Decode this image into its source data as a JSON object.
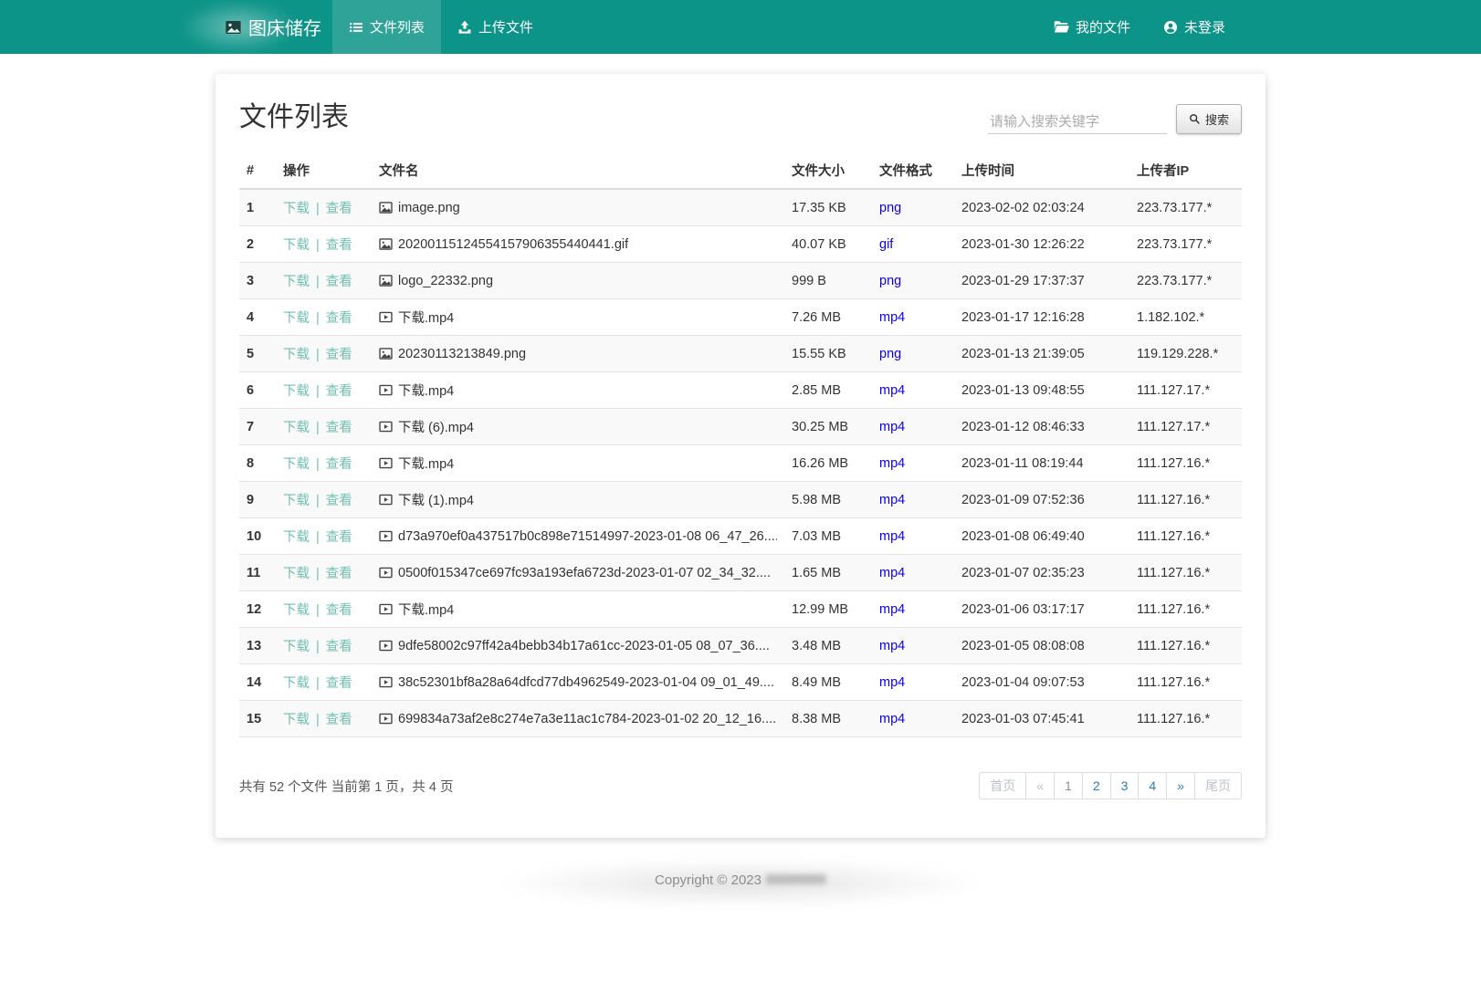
{
  "navbar": {
    "brand": "图床储存",
    "items": [
      {
        "id": "file-list",
        "label": "文件列表",
        "icon": "list-icon",
        "active": true
      },
      {
        "id": "upload-file",
        "label": "上传文件",
        "icon": "upload-icon",
        "active": false
      }
    ],
    "right_items": [
      {
        "id": "my-files",
        "label": "我的文件",
        "icon": "folder-icon"
      },
      {
        "id": "login-status",
        "label": "未登录",
        "icon": "user-icon"
      }
    ]
  },
  "page": {
    "title": "文件列表"
  },
  "search": {
    "placeholder": "请输入搜索关键字",
    "button_label": "搜索"
  },
  "table": {
    "headers": [
      "#",
      "操作",
      "文件名",
      "文件大小",
      "文件格式",
      "上传时间",
      "上传者IP"
    ],
    "action_labels": {
      "download": "下载",
      "separator": "|",
      "view": "查看"
    },
    "rows": [
      {
        "index": 1,
        "icon": "image-icon",
        "filename": "image.png",
        "size": "17.35 KB",
        "format": "png",
        "time": "2023-02-02 02:03:24",
        "ip": "223.73.177.*"
      },
      {
        "index": 2,
        "icon": "image-icon",
        "filename": "20200115124554157906355440441.gif",
        "size": "40.07 KB",
        "format": "gif",
        "time": "2023-01-30 12:26:22",
        "ip": "223.73.177.*"
      },
      {
        "index": 3,
        "icon": "image-icon",
        "filename": "logo_22332.png",
        "size": "999 B",
        "format": "png",
        "time": "2023-01-29 17:37:37",
        "ip": "223.73.177.*"
      },
      {
        "index": 4,
        "icon": "video-icon",
        "filename": "下载.mp4",
        "size": "7.26 MB",
        "format": "mp4",
        "time": "2023-01-17 12:16:28",
        "ip": "1.182.102.*"
      },
      {
        "index": 5,
        "icon": "image-icon",
        "filename": "20230113213849.png",
        "size": "15.55 KB",
        "format": "png",
        "time": "2023-01-13 21:39:05",
        "ip": "119.129.228.*"
      },
      {
        "index": 6,
        "icon": "video-icon",
        "filename": "下载.mp4",
        "size": "2.85 MB",
        "format": "mp4",
        "time": "2023-01-13 09:48:55",
        "ip": "111.127.17.*"
      },
      {
        "index": 7,
        "icon": "video-icon",
        "filename": "下载 (6).mp4",
        "size": "30.25 MB",
        "format": "mp4",
        "time": "2023-01-12 08:46:33",
        "ip": "111.127.17.*"
      },
      {
        "index": 8,
        "icon": "video-icon",
        "filename": "下载.mp4",
        "size": "16.26 MB",
        "format": "mp4",
        "time": "2023-01-11 08:19:44",
        "ip": "111.127.16.*"
      },
      {
        "index": 9,
        "icon": "video-icon",
        "filename": "下载 (1).mp4",
        "size": "5.98 MB",
        "format": "mp4",
        "time": "2023-01-09 07:52:36",
        "ip": "111.127.16.*"
      },
      {
        "index": 10,
        "icon": "video-icon",
        "filename": "d73a970ef0a437517b0c898e71514997-2023-01-08 06_47_26....",
        "size": "7.03 MB",
        "format": "mp4",
        "time": "2023-01-08 06:49:40",
        "ip": "111.127.16.*"
      },
      {
        "index": 11,
        "icon": "video-icon",
        "filename": "0500f015347ce697fc93a193efa6723d-2023-01-07 02_34_32....",
        "size": "1.65 MB",
        "format": "mp4",
        "time": "2023-01-07 02:35:23",
        "ip": "111.127.16.*"
      },
      {
        "index": 12,
        "icon": "video-icon",
        "filename": "下载.mp4",
        "size": "12.99 MB",
        "format": "mp4",
        "time": "2023-01-06 03:17:17",
        "ip": "111.127.16.*"
      },
      {
        "index": 13,
        "icon": "video-icon",
        "filename": "9dfe58002c97ff42a4bebb34b17a61cc-2023-01-05 08_07_36....",
        "size": "3.48 MB",
        "format": "mp4",
        "time": "2023-01-05 08:08:08",
        "ip": "111.127.16.*"
      },
      {
        "index": 14,
        "icon": "video-icon",
        "filename": "38c52301bf8a28a64dfcd77db4962549-2023-01-04 09_01_49....",
        "size": "8.49 MB",
        "format": "mp4",
        "time": "2023-01-04 09:07:53",
        "ip": "111.127.16.*"
      },
      {
        "index": 15,
        "icon": "video-icon",
        "filename": "699834a73af2e8c274e7a3e11ac1c784-2023-01-02 20_12_16....",
        "size": "8.38 MB",
        "format": "mp4",
        "time": "2023-01-03 07:45:41",
        "ip": "111.127.16.*"
      }
    ]
  },
  "summary": {
    "text": "共有 52 个文件  当前第 1 页，共 4 页",
    "total_files": "52",
    "current_page": "1",
    "total_pages": "4"
  },
  "pagination": {
    "items": [
      {
        "name": "first-page",
        "label": "首页",
        "state": "disabled"
      },
      {
        "name": "prev-page",
        "label": "«",
        "state": "disabled"
      },
      {
        "name": "page-1",
        "label": "1",
        "state": "current"
      },
      {
        "name": "page-2",
        "label": "2",
        "state": "link"
      },
      {
        "name": "page-3",
        "label": "3",
        "state": "link"
      },
      {
        "name": "page-4",
        "label": "4",
        "state": "link"
      },
      {
        "name": "next-page",
        "label": "»",
        "state": "link"
      },
      {
        "name": "last-page",
        "label": "尾页",
        "state": "disabled"
      }
    ]
  },
  "footer": {
    "copyright": "Copyright © 2023"
  },
  "colors": {
    "navbar_background": "#0d9488",
    "action_link": "#6ec0b1",
    "format_link": "#0b00e6",
    "pagination_link": "#337ab7"
  }
}
